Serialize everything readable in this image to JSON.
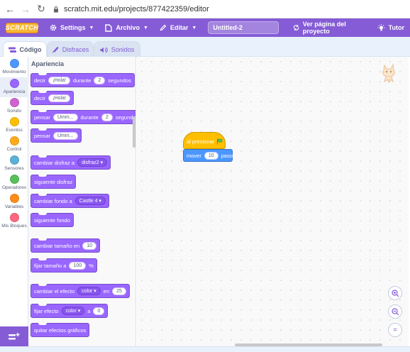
{
  "browser": {
    "url": "scratch.mit.edu/projects/877422359/editor"
  },
  "menu": {
    "logo": "SCRATCH",
    "settings": "Settings",
    "file": "Archivo",
    "edit": "Editar",
    "project_title": "Untitled-2",
    "see_project": "Ver página del proyecto",
    "tutorials": "Tutor"
  },
  "tabs": {
    "code": "Código",
    "costumes": "Disfraces",
    "sounds": "Sonidos"
  },
  "categories": [
    {
      "label": "Movimiento",
      "color": "#4c97ff"
    },
    {
      "label": "Apariencia",
      "color": "#9966ff"
    },
    {
      "label": "Sonido",
      "color": "#cf63cf"
    },
    {
      "label": "Eventos",
      "color": "#ffbf00"
    },
    {
      "label": "Control",
      "color": "#ffab19"
    },
    {
      "label": "Sensores",
      "color": "#5cb1d6"
    },
    {
      "label": "Operadores",
      "color": "#59c059"
    },
    {
      "label": "Variables",
      "color": "#ff8c1a"
    },
    {
      "label": "Mis Bloques",
      "color": "#ff6680"
    }
  ],
  "palette": {
    "title": "Apariencia",
    "say_for": {
      "t1": "decir",
      "v1": "¡Hola!",
      "t2": "durante",
      "v2": "2",
      "t3": "segundos"
    },
    "say": {
      "t1": "decir",
      "v1": "¡Hola!"
    },
    "think_for": {
      "t1": "pensar",
      "v1": "Umm...",
      "t2": "durante",
      "v2": "2",
      "t3": "segundos"
    },
    "think": {
      "t1": "pensar",
      "v1": "Umm..."
    },
    "switch_costume": {
      "t1": "cambiar disfraz a",
      "v1": "disfraz2"
    },
    "next_costume": "siguiente disfraz",
    "switch_backdrop": {
      "t1": "cambiar fondo a",
      "v1": "Castle 4"
    },
    "next_backdrop": "siguiente fondo",
    "change_size": {
      "t1": "cambiar tamaño en",
      "v1": "10"
    },
    "set_size": {
      "t1": "fijar tamaño a",
      "v1": "100",
      "t2": "%"
    },
    "change_effect": {
      "t1": "cambiar el efecto",
      "v1": "color",
      "t2": "en",
      "v2": "25"
    },
    "set_effect": {
      "t1": "fijar efecto",
      "v1": "color",
      "t2": "a",
      "v2": "0"
    },
    "clear_effects": "quitar efectos gráficos"
  },
  "script": {
    "hat_label": "al presionar",
    "move_label": "mover",
    "move_value": "10",
    "move_unit": "pasos"
  },
  "zoom": {
    "in": "+",
    "out": "−",
    "reset": "="
  }
}
